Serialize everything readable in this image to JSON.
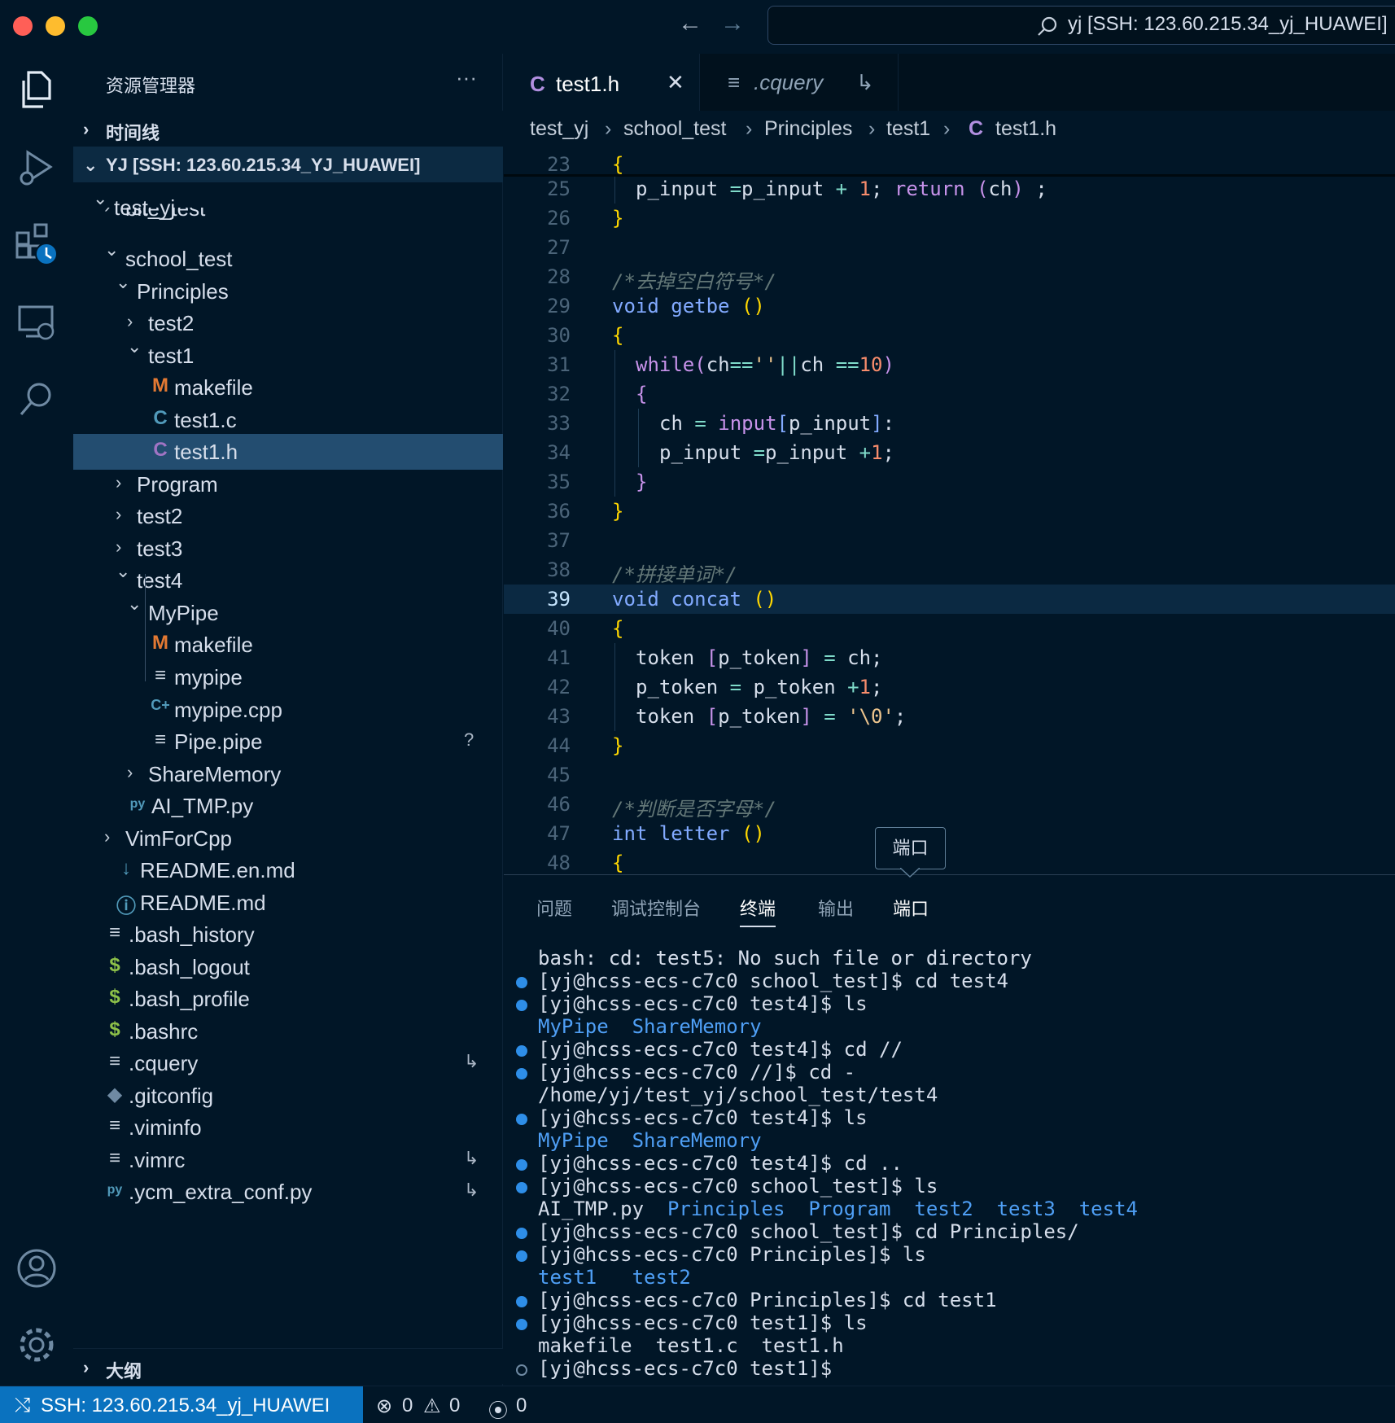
{
  "window": {
    "command_center": "yj [SSH: 123.60.215.34_yj_HUAWEI]"
  },
  "sidebar": {
    "title": "资源管理器",
    "more": "···",
    "timeline": "时间线",
    "workspace": "YJ [SSH: 123.60.215.34_YJ_HUAWEI]",
    "outline": "大纲",
    "tree": [
      {
        "label": "test_yj",
        "depth": 0,
        "kind": "folder-open"
      },
      {
        "label": "bite_test",
        "depth": 1,
        "kind": "folder-closed"
      },
      {
        "label": "school_test",
        "depth": 1,
        "kind": "folder-open"
      },
      {
        "label": "Principles",
        "depth": 2,
        "kind": "folder-open"
      },
      {
        "label": "test2",
        "depth": 3,
        "kind": "folder-closed"
      },
      {
        "label": "test1",
        "depth": 3,
        "kind": "folder-open"
      },
      {
        "label": "makefile",
        "depth": 4,
        "kind": "makefile",
        "icon": "M"
      },
      {
        "label": "test1.c",
        "depth": 4,
        "kind": "c",
        "icon": "C"
      },
      {
        "label": "test1.h",
        "depth": 4,
        "kind": "h",
        "icon": "C",
        "selected": true
      },
      {
        "label": "Program",
        "depth": 2,
        "kind": "folder-closed"
      },
      {
        "label": "test2",
        "depth": 2,
        "kind": "folder-closed"
      },
      {
        "label": "test3",
        "depth": 2,
        "kind": "folder-closed"
      },
      {
        "label": "test4",
        "depth": 2,
        "kind": "folder-open"
      },
      {
        "label": "MyPipe",
        "depth": 3,
        "kind": "folder-open"
      },
      {
        "label": "makefile",
        "depth": 4,
        "kind": "makefile",
        "icon": "M"
      },
      {
        "label": "mypipe",
        "depth": 4,
        "kind": "text",
        "icon": "≡"
      },
      {
        "label": "mypipe.cpp",
        "depth": 4,
        "kind": "cpp",
        "icon": "C+"
      },
      {
        "label": "Pipe.pipe",
        "depth": 4,
        "kind": "text",
        "icon": "≡",
        "decoration": "?"
      },
      {
        "label": "ShareMemory",
        "depth": 3,
        "kind": "folder-closed"
      },
      {
        "label": "AI_TMP.py",
        "depth": 2,
        "kind": "python",
        "icon": "py"
      },
      {
        "label": "VimForCpp",
        "depth": 1,
        "kind": "folder-closed"
      },
      {
        "label": "README.en.md",
        "depth": 1,
        "kind": "markdown",
        "icon": "↓"
      },
      {
        "label": "README.md",
        "depth": 1,
        "kind": "info",
        "icon": "ⓘ"
      },
      {
        "label": ".bash_history",
        "depth": 0,
        "kind": "text",
        "icon": "≡"
      },
      {
        "label": ".bash_logout",
        "depth": 0,
        "kind": "shell",
        "icon": "$"
      },
      {
        "label": ".bash_profile",
        "depth": 0,
        "kind": "shell",
        "icon": "$"
      },
      {
        "label": ".bashrc",
        "depth": 0,
        "kind": "shell",
        "icon": "$"
      },
      {
        "label": ".cquery",
        "depth": 0,
        "kind": "text",
        "icon": "≡",
        "decoration": "↳"
      },
      {
        "label": ".gitconfig",
        "depth": 0,
        "kind": "git",
        "icon": "◆"
      },
      {
        "label": ".viminfo",
        "depth": 0,
        "kind": "text",
        "icon": "≡"
      },
      {
        "label": ".vimrc",
        "depth": 0,
        "kind": "text",
        "icon": "≡",
        "decoration": "↳"
      },
      {
        "label": ".ycm_extra_conf.py",
        "depth": 0,
        "kind": "python",
        "icon": "py",
        "decoration": "↳"
      }
    ]
  },
  "editor": {
    "tabs": [
      {
        "icon": "C",
        "label": "test1.h",
        "close": "✕"
      },
      {
        "icon": "≡",
        "label": ".cquery",
        "suffix": "↳"
      }
    ],
    "breadcrumb": [
      "test_yj",
      "school_test",
      "Principles",
      "test1",
      "test1.h"
    ],
    "breadcrumb_icon": "C",
    "lines": [
      {
        "n": "23",
        "code": [
          [
            "pr",
            "{"
          ]
        ]
      },
      {
        "n": "25",
        "code": [
          [
            "vr",
            "p_input "
          ],
          [
            "op",
            "="
          ],
          [
            "vr",
            "p_input "
          ],
          [
            "op",
            "+ "
          ],
          [
            "nm",
            "1"
          ],
          [
            "vr",
            "; "
          ],
          [
            "pk",
            "return "
          ],
          [
            "pk",
            "("
          ],
          [
            "vr",
            "ch"
          ],
          [
            "pk",
            ")"
          ],
          [
            "vr",
            " ;"
          ]
        ],
        "ind": 1
      },
      {
        "n": "26",
        "code": [
          [
            "pr",
            "}"
          ]
        ]
      },
      {
        "n": "27",
        "code": []
      },
      {
        "n": "28",
        "code": [
          [
            "cm",
            "/*去掉空白符号*/"
          ]
        ]
      },
      {
        "n": "29",
        "code": [
          [
            "kw",
            "void "
          ],
          [
            "fn",
            "getbe "
          ],
          [
            "pr",
            "()"
          ]
        ]
      },
      {
        "n": "30",
        "code": [
          [
            "pr",
            "{"
          ]
        ]
      },
      {
        "n": "31",
        "code": [
          [
            "pk",
            "while"
          ],
          [
            "pk",
            "("
          ],
          [
            "vr",
            "ch"
          ],
          [
            "op",
            "=="
          ],
          [
            "st",
            "''"
          ],
          [
            "op",
            "||"
          ],
          [
            "vr",
            "ch "
          ],
          [
            "op",
            "=="
          ],
          [
            "nm",
            "10"
          ],
          [
            "pk",
            ")"
          ]
        ],
        "ind": 1
      },
      {
        "n": "32",
        "code": [
          [
            "pk",
            "{"
          ]
        ],
        "ind": 1
      },
      {
        "n": "33",
        "code": [
          [
            "vr",
            "ch "
          ],
          [
            "op",
            "= "
          ],
          [
            "pk",
            "input"
          ],
          [
            "fn",
            "["
          ],
          [
            "vr",
            "p_input"
          ],
          [
            "fn",
            "]"
          ],
          [
            "vr",
            ":"
          ]
        ],
        "ind": 2
      },
      {
        "n": "34",
        "code": [
          [
            "vr",
            "p_input "
          ],
          [
            "op",
            "="
          ],
          [
            "vr",
            "p_input "
          ],
          [
            "op",
            "+"
          ],
          [
            "nm",
            "1"
          ],
          [
            "vr",
            ";"
          ]
        ],
        "ind": 2
      },
      {
        "n": "35",
        "code": [
          [
            "pk",
            "}"
          ]
        ],
        "ind": 1
      },
      {
        "n": "36",
        "code": [
          [
            "pr",
            "}"
          ]
        ]
      },
      {
        "n": "37",
        "code": []
      },
      {
        "n": "38",
        "code": [
          [
            "cm",
            "/*拼接单词*/"
          ]
        ]
      },
      {
        "n": "39",
        "code": [
          [
            "kw",
            "void "
          ],
          [
            "fn",
            "concat "
          ],
          [
            "pr",
            "()"
          ]
        ],
        "current": true
      },
      {
        "n": "40",
        "code": [
          [
            "pr",
            "{"
          ]
        ]
      },
      {
        "n": "41",
        "code": [
          [
            "vr",
            "token "
          ],
          [
            "pk",
            "["
          ],
          [
            "vr",
            "p_token"
          ],
          [
            "pk",
            "]"
          ],
          [
            "op",
            " = "
          ],
          [
            "vr",
            "ch;"
          ]
        ],
        "ind": 1
      },
      {
        "n": "42",
        "code": [
          [
            "vr",
            "p_token "
          ],
          [
            "op",
            "= "
          ],
          [
            "vr",
            "p_token "
          ],
          [
            "op",
            "+"
          ],
          [
            "nm",
            "1"
          ],
          [
            "vr",
            ";"
          ]
        ],
        "ind": 1
      },
      {
        "n": "43",
        "code": [
          [
            "vr",
            "token "
          ],
          [
            "pk",
            "["
          ],
          [
            "vr",
            "p_token"
          ],
          [
            "pk",
            "]"
          ],
          [
            "op",
            " = "
          ],
          [
            "st",
            "'\\0'"
          ],
          [
            "vr",
            ";"
          ]
        ],
        "ind": 1
      },
      {
        "n": "44",
        "code": [
          [
            "pr",
            "}"
          ]
        ]
      },
      {
        "n": "45",
        "code": []
      },
      {
        "n": "46",
        "code": [
          [
            "cm",
            "/*判断是否字母*/"
          ]
        ]
      },
      {
        "n": "47",
        "code": [
          [
            "kw",
            "int "
          ],
          [
            "fn",
            "letter "
          ],
          [
            "pr",
            "()"
          ]
        ]
      },
      {
        "n": "48",
        "code": [
          [
            "pr",
            "{"
          ]
        ]
      }
    ]
  },
  "tooltip": "端口",
  "panel": {
    "tabs": [
      "问题",
      "调试控制台",
      "终端",
      "输出",
      "端口"
    ],
    "active_tab": 2,
    "terminal": [
      {
        "dot": "none",
        "parts": [
          [
            "t",
            "bash: cd: test5: No such file or directory"
          ]
        ]
      },
      {
        "dot": "filled",
        "parts": [
          [
            "t",
            "[yj@hcss-ecs-c7c0 school_test]$ cd test4"
          ]
        ]
      },
      {
        "dot": "filled",
        "parts": [
          [
            "t",
            "[yj@hcss-ecs-c7c0 test4]$ ls"
          ]
        ]
      },
      {
        "dot": "none",
        "parts": [
          [
            "d",
            "MyPipe"
          ],
          [
            "t",
            "  "
          ],
          [
            "d",
            "ShareMemory"
          ]
        ]
      },
      {
        "dot": "filled",
        "parts": [
          [
            "t",
            "[yj@hcss-ecs-c7c0 test4]$ cd //"
          ]
        ]
      },
      {
        "dot": "filled",
        "parts": [
          [
            "t",
            "[yj@hcss-ecs-c7c0 //]$ cd -"
          ]
        ]
      },
      {
        "dot": "none",
        "parts": [
          [
            "t",
            "/home/yj/test_yj/school_test/test4"
          ]
        ]
      },
      {
        "dot": "filled",
        "parts": [
          [
            "t",
            "[yj@hcss-ecs-c7c0 test4]$ ls"
          ]
        ]
      },
      {
        "dot": "none",
        "parts": [
          [
            "d",
            "MyPipe"
          ],
          [
            "t",
            "  "
          ],
          [
            "d",
            "ShareMemory"
          ]
        ]
      },
      {
        "dot": "filled",
        "parts": [
          [
            "t",
            "[yj@hcss-ecs-c7c0 test4]$ cd .."
          ]
        ]
      },
      {
        "dot": "filled",
        "parts": [
          [
            "t",
            "[yj@hcss-ecs-c7c0 school_test]$ ls"
          ]
        ]
      },
      {
        "dot": "none",
        "parts": [
          [
            "t",
            "AI_TMP.py  "
          ],
          [
            "d",
            "Principles"
          ],
          [
            "t",
            "  "
          ],
          [
            "d",
            "Program"
          ],
          [
            "t",
            "  "
          ],
          [
            "d",
            "test2"
          ],
          [
            "t",
            "  "
          ],
          [
            "d",
            "test3"
          ],
          [
            "t",
            "  "
          ],
          [
            "d",
            "test4"
          ]
        ]
      },
      {
        "dot": "filled",
        "parts": [
          [
            "t",
            "[yj@hcss-ecs-c7c0 school_test]$ cd Principles/"
          ]
        ]
      },
      {
        "dot": "filled",
        "parts": [
          [
            "t",
            "[yj@hcss-ecs-c7c0 Principles]$ ls"
          ]
        ]
      },
      {
        "dot": "none",
        "parts": [
          [
            "d",
            "test1"
          ],
          [
            "t",
            "   "
          ],
          [
            "d",
            "test2"
          ]
        ]
      },
      {
        "dot": "filled",
        "parts": [
          [
            "t",
            "[yj@hcss-ecs-c7c0 Principles]$ cd test1"
          ]
        ]
      },
      {
        "dot": "filled",
        "parts": [
          [
            "t",
            "[yj@hcss-ecs-c7c0 test1]$ ls"
          ]
        ]
      },
      {
        "dot": "none",
        "parts": [
          [
            "t",
            "makefile  test1.c  test1.h"
          ]
        ]
      },
      {
        "dot": "empty",
        "parts": [
          [
            "t",
            "[yj@hcss-ecs-c7c0 test1]$ "
          ]
        ]
      }
    ]
  },
  "status": {
    "remote": "SSH: 123.60.215.34_yj_HUAWEI",
    "errors": "0",
    "warnings": "0",
    "ports": "0"
  },
  "colors": {
    "bg": "#011627",
    "accent": "#0a72bf",
    "selection": "#234d70"
  }
}
